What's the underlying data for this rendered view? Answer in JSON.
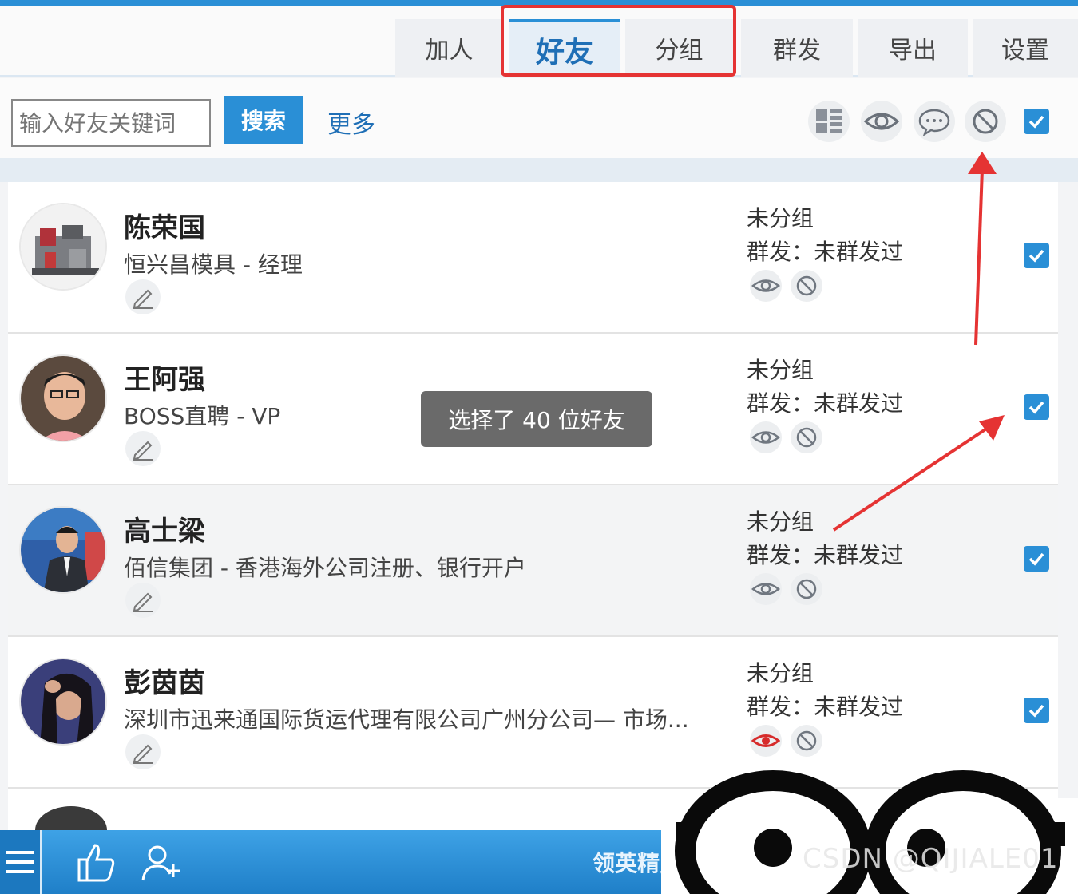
{
  "tabs": [
    {
      "label": "加人"
    },
    {
      "label": "好友",
      "active": true
    },
    {
      "label": "分组"
    },
    {
      "label": "群发"
    },
    {
      "label": "导出"
    },
    {
      "label": "设置"
    }
  ],
  "search": {
    "placeholder": "输入好友关键词",
    "button_label": "搜索",
    "more_label": "更多"
  },
  "toolbar_icons": [
    "list-view-icon",
    "eye-icon",
    "chat-bubble-icon",
    "block-icon"
  ],
  "toast": "选择了 40 位好友",
  "friends": [
    {
      "name": "陈荣国",
      "title": "恒兴昌模具 - 经理",
      "group": "未分组",
      "broadcast": "群发：未群发过",
      "eye_active": false,
      "checked": true
    },
    {
      "name": "王阿强",
      "title": "BOSS直聘 - VP",
      "group": "未分组",
      "broadcast": "群发：未群发过",
      "eye_active": false,
      "checked": true
    },
    {
      "name": "高士梁",
      "title": "佰信集团 - 香港海外公司注册、银行开户",
      "group": "未分组",
      "broadcast": "群发：未群发过",
      "eye_active": false,
      "checked": true
    },
    {
      "name": "彭茵茵",
      "title": "深圳市迅来通国际货运代理有限公司广州分公司— 市场...",
      "group": "未分组",
      "broadcast": "群发：未群发过",
      "eye_active": true,
      "checked": true
    }
  ],
  "bottombar": {
    "brand": "领英精灵"
  },
  "watermark": "CSDN @QIJIALE01",
  "colors": {
    "accent": "#2a8fd6",
    "highlight": "#e53333",
    "eye_active": "#d62b2b"
  }
}
